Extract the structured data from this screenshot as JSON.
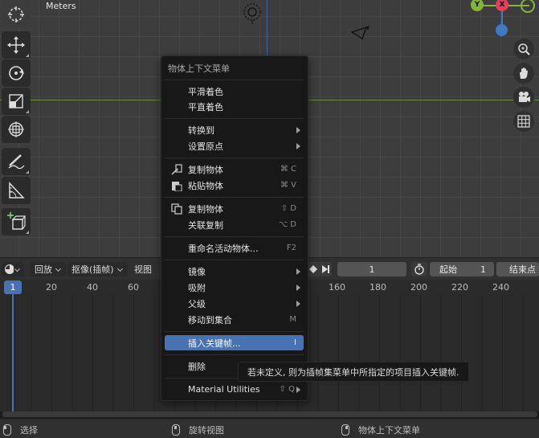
{
  "viewport": {
    "units_label": "Meters"
  },
  "gizmo": {
    "y_label": "Y",
    "x_label": "X",
    "colors": {
      "x": "#e2415a",
      "y": "#88b33a",
      "z": "#3d7ac6"
    }
  },
  "toolbar": {
    "tools": [
      "cursor-tool",
      "move-tool",
      "rotate-tool",
      "scale-tool",
      "transform-tool",
      "annotate-tool",
      "measure-tool",
      "add-cube-tool"
    ]
  },
  "nav_buttons": [
    "zoom-in",
    "pan-hand",
    "camera",
    "grid"
  ],
  "context_menu": {
    "title": "物体上下文菜单",
    "items": [
      {
        "label": "平滑着色",
        "shortcut": ""
      },
      {
        "label": "平直着色",
        "shortcut": ""
      },
      {
        "label": "转换到",
        "shortcut": ""
      },
      {
        "label": "设置原点",
        "shortcut": ""
      },
      {
        "label": "复制物体",
        "shortcut": "⌘ C"
      },
      {
        "label": "粘贴物体",
        "shortcut": "⌘ V"
      },
      {
        "label": "复制物体",
        "shortcut": "⇧ D"
      },
      {
        "label": "关联复制",
        "shortcut": "⌥ D"
      },
      {
        "label": "重命名活动物体...",
        "shortcut": "F2"
      },
      {
        "label": "镜像",
        "shortcut": ""
      },
      {
        "label": "吸附",
        "shortcut": ""
      },
      {
        "label": "父级",
        "shortcut": ""
      },
      {
        "label": "移动到集合",
        "shortcut": "M"
      },
      {
        "label": "插入关键帧...",
        "shortcut": "I"
      },
      {
        "label": "删除",
        "shortcut": ""
      },
      {
        "label": "Material Utilities",
        "shortcut": "⇧ Q"
      }
    ]
  },
  "tooltip": {
    "text": "若未定义, 则为插帧集菜单中所指定的项目插入关键帧."
  },
  "timeline": {
    "playback_label": "回放",
    "keying_label": "抠像(插帧)",
    "view_label": "视图",
    "current_frame": "1",
    "start_label": "起始",
    "start_value": "1",
    "end_label": "结束点",
    "ruler_numbers": [
      "20",
      "40",
      "60",
      "160",
      "180",
      "200",
      "220",
      "240"
    ],
    "playhead_frame": "1"
  },
  "statusbar": {
    "select": "选择",
    "rotate_view": "旋转视图",
    "context_menu": "物体上下文菜单"
  }
}
